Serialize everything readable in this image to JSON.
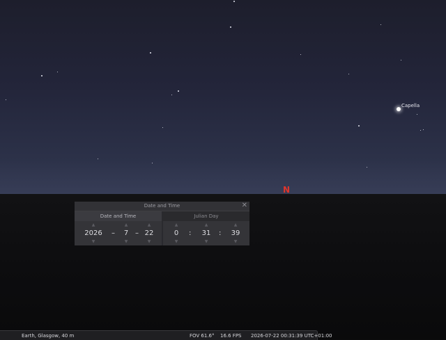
{
  "sky": {
    "capella_label": "Capella",
    "north_label": "N"
  },
  "dialog": {
    "title": "Date and Time",
    "close_icon": "close-icon",
    "tabs": [
      {
        "label": "Date and Time"
      },
      {
        "label": "Julian Day"
      }
    ],
    "date": {
      "year": "2026",
      "month": "7",
      "day": "22",
      "separator": "–"
    },
    "time": {
      "hour": "0",
      "minute": "31",
      "second": "39",
      "separator": ":"
    },
    "spinner_icons": {
      "up": "triangle-up-icon",
      "down": "triangle-down-icon"
    }
  },
  "status": {
    "location": "Earth, Glasgow, 40 m",
    "fov": "FOV 61.6°",
    "fps": "16.6 FPS",
    "datetime": "2026-07-22 00:31:39 UTC+01:00"
  },
  "colors": {
    "north_cardinal": "#e0352c",
    "sky_top": "#1d1e2c",
    "sky_horizon": "#323851",
    "ground": "#0d0d0f"
  }
}
